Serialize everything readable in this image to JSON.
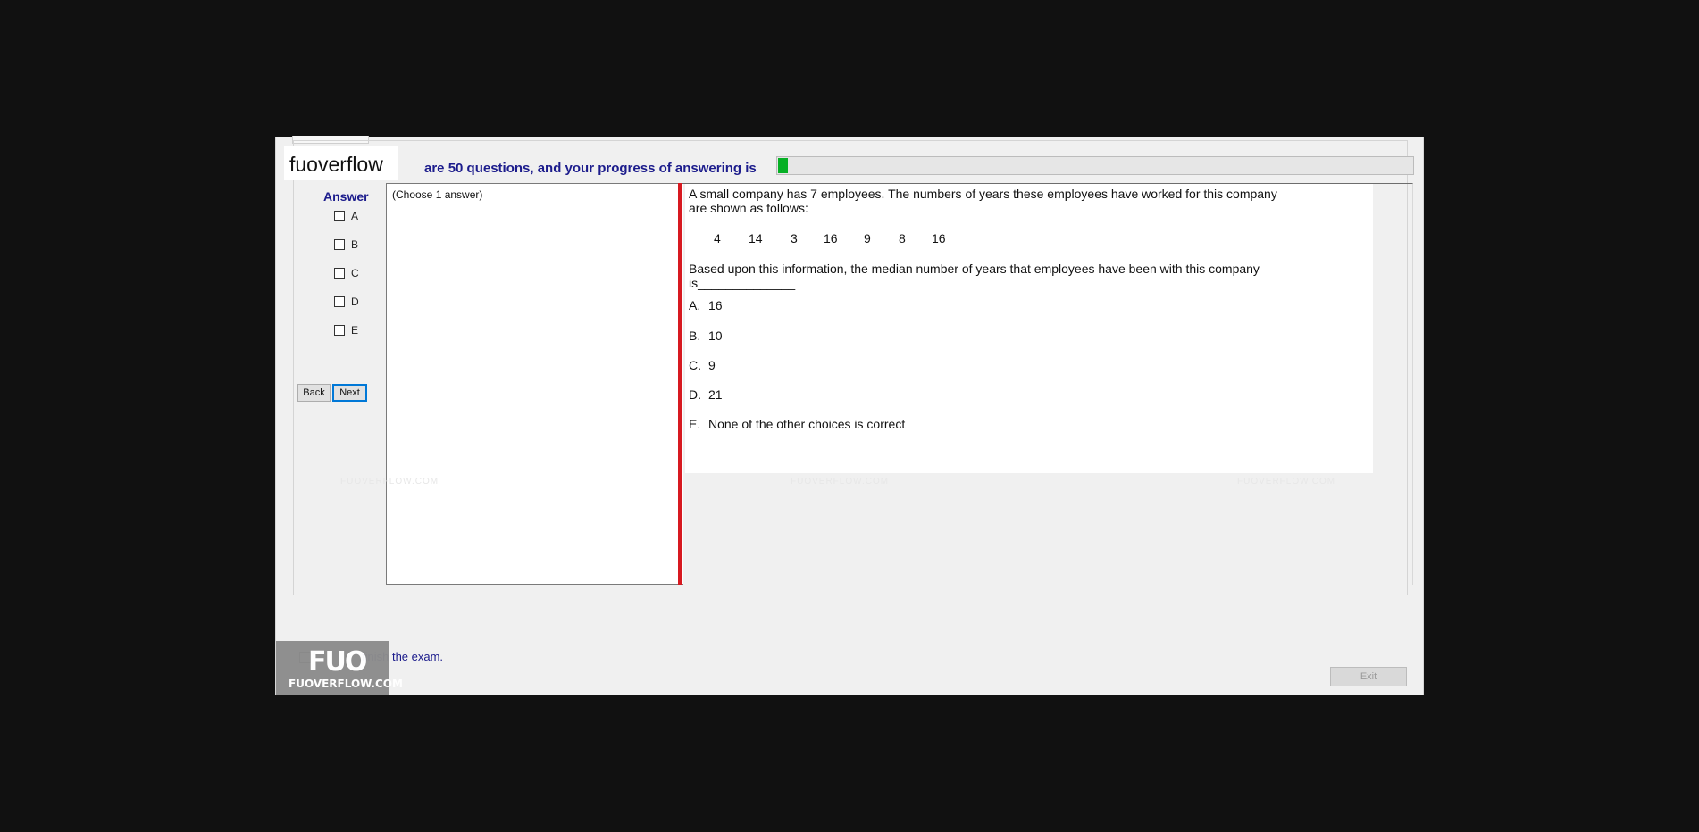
{
  "logo": {
    "text": "fuoverflow"
  },
  "progress": {
    "label": "are 50 questions, and your progress of answering is",
    "fraction": 0.015,
    "color": "#06b025"
  },
  "answer_panel": {
    "title": "Answer",
    "options": [
      "A",
      "B",
      "C",
      "D",
      "E"
    ],
    "hint": "(Choose 1 answer)"
  },
  "nav": {
    "back": "Back",
    "next": "Next"
  },
  "question": {
    "line1": "A small company has 7 employees.  The numbers of years these employees have worked for this company",
    "line2": "are shown as follows:",
    "numbers": [
      "4",
      "14",
      "3",
      "16",
      "9",
      "8",
      "16"
    ],
    "prompt1": "Based upon this information, the median number of years that employees have been with this company",
    "prompt2": "is______________",
    "choices": [
      {
        "letter": "A.",
        "text": "16"
      },
      {
        "letter": "B.",
        "text": "10"
      },
      {
        "letter": "C.",
        "text": "9"
      },
      {
        "letter": "D.",
        "text": "21"
      },
      {
        "letter": "E.",
        "text": "None of the other choices is correct"
      }
    ]
  },
  "watermarks": [
    "FUOVERFLOW.COM",
    "FUOVERFLOW.COM",
    "FUOVERFLOW.COM"
  ],
  "finish": {
    "text": "finish the exam."
  },
  "exit": {
    "label": "Exit"
  },
  "badge": {
    "big": "FUO",
    "small": "FUOVERFLOW.COM"
  },
  "colors": {
    "accent": "#1c1c8c",
    "separator": "#d71920"
  }
}
